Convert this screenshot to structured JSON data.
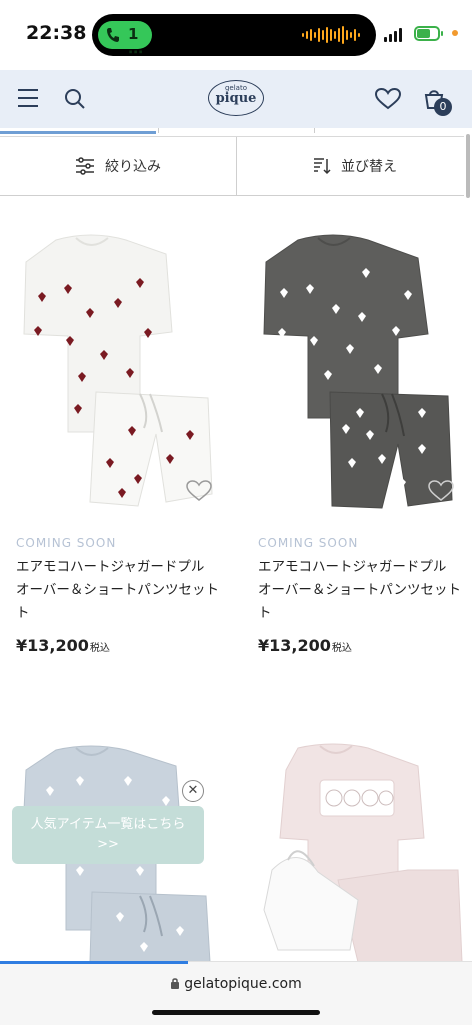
{
  "status_bar": {
    "time": "22:38",
    "call_label": "1 ⋯"
  },
  "header": {
    "logo_small": "gelato",
    "logo_big": "pique",
    "cart_count": "0"
  },
  "filter_bar": {
    "filter_label": "絞り込み",
    "sort_label": "並び替え"
  },
  "products": [
    {
      "status": "COMING SOON",
      "name_line1": "エアモコハートジャガードプル",
      "name_line2": "オーバー＆ショートパンツセット",
      "name_line3": "ト",
      "price": "¥13,200",
      "tax": "税込",
      "color": "#f4f4f2",
      "heart_color": "#7a1a22"
    },
    {
      "status": "COMING SOON",
      "name_line1": "エアモコハートジャガードプル",
      "name_line2": "オーバー＆ショートパンツセット",
      "name_line3": "ト",
      "price": "¥13,200",
      "tax": "税込",
      "color": "#5e5e5c",
      "heart_color": "#ffffff"
    }
  ],
  "popup": {
    "line1": "人気アイテム一覧はこちら",
    "line2": ">>",
    "close": "✕"
  },
  "url_bar": {
    "url": "gelatopique.com"
  },
  "colors": {
    "header_bg": "#e8eef7",
    "accent": "#2c3e5a",
    "popup_bg": "#c4ddd8",
    "progress": "#2f7de1"
  }
}
